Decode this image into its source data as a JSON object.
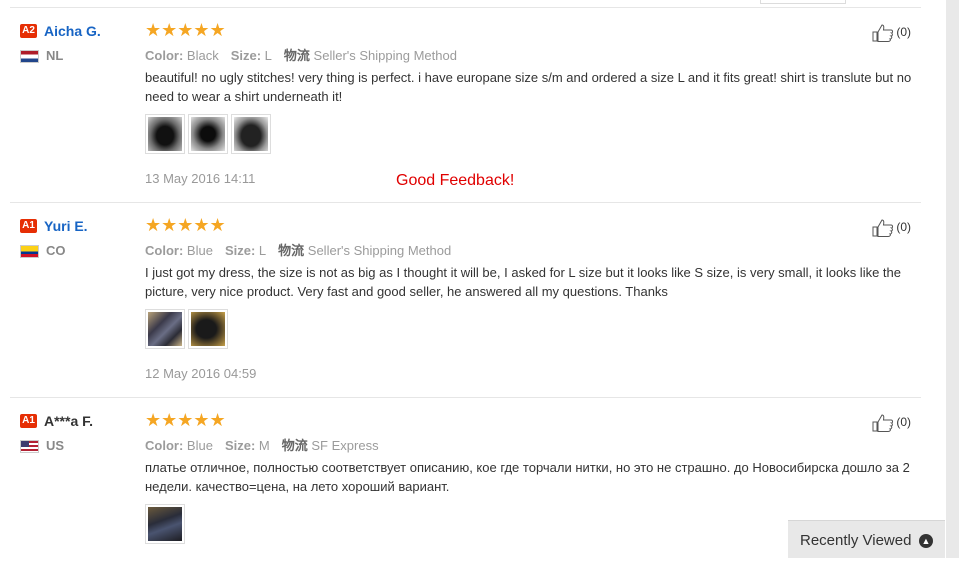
{
  "reviews": [
    {
      "level": "A2",
      "name": "Aicha G.",
      "country": "NL",
      "stars": "★★★★★",
      "color_label": "Color:",
      "color_value": "Black",
      "size_label": "Size:",
      "size_value": "L",
      "shipping_label": "物流",
      "shipping_value": "Seller's Shipping Method",
      "text": "beautiful! no ugly stitches! very thing is perfect. i have europane size s/m and ordered a size L and it fits great! shirt is translute but no need to wear a shirt underneath it!",
      "date": "13 May 2016 14:11",
      "likes": "(0)"
    },
    {
      "level": "A1",
      "name": "Yuri E.",
      "country": "CO",
      "stars": "★★★★★",
      "color_label": "Color:",
      "color_value": "Blue",
      "size_label": "Size:",
      "size_value": "L",
      "shipping_label": "物流",
      "shipping_value": "Seller's Shipping Method",
      "text": "I just got my dress, the size is not as big as I thought it will be, I asked for L size but it looks like S size, is very small, it looks like the picture, very nice product. Very fast and good seller, he answered all my questions. Thanks",
      "date": "12 May 2016 04:59",
      "likes": "(0)"
    },
    {
      "level": "A1",
      "name": "A***a F.",
      "country": "US",
      "stars": "★★★★★",
      "color_label": "Color:",
      "color_value": "Blue",
      "size_label": "Size:",
      "size_value": "M",
      "shipping_label": "物流",
      "shipping_value": "SF Express",
      "text": "платье отличное, полностью соответствует описанию, кое где торчали нитки, но это не страшно. до Новосибирска дошло за 2 недели. качество=цена, на лето хороший вариант.",
      "likes": "(0)"
    }
  ],
  "annotation": "Good Feedback!",
  "recently_viewed": {
    "label": "Recently Viewed",
    "icon": "chevron-up-icon"
  },
  "colors": {
    "level_badge": "#e62e04",
    "name_blue": "#1764c4",
    "stars": "#f5a623",
    "annotation": "#e00000"
  }
}
